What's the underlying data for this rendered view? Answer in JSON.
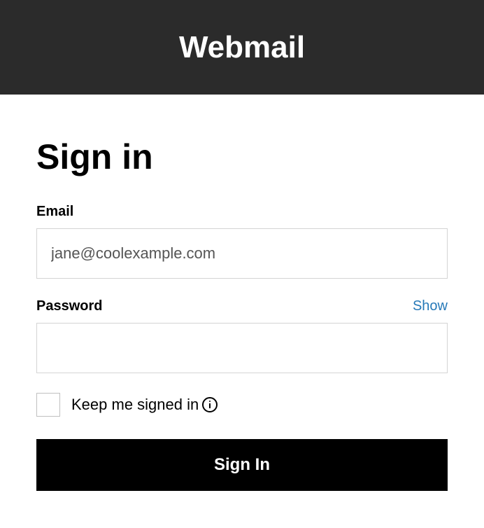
{
  "header": {
    "title": "Webmail"
  },
  "form": {
    "title": "Sign in",
    "email": {
      "label": "Email",
      "value": "jane@coolexample.com"
    },
    "password": {
      "label": "Password",
      "show_label": "Show",
      "value": ""
    },
    "keep_signed_in": {
      "label": "Keep me signed in"
    },
    "submit_label": "Sign In"
  }
}
